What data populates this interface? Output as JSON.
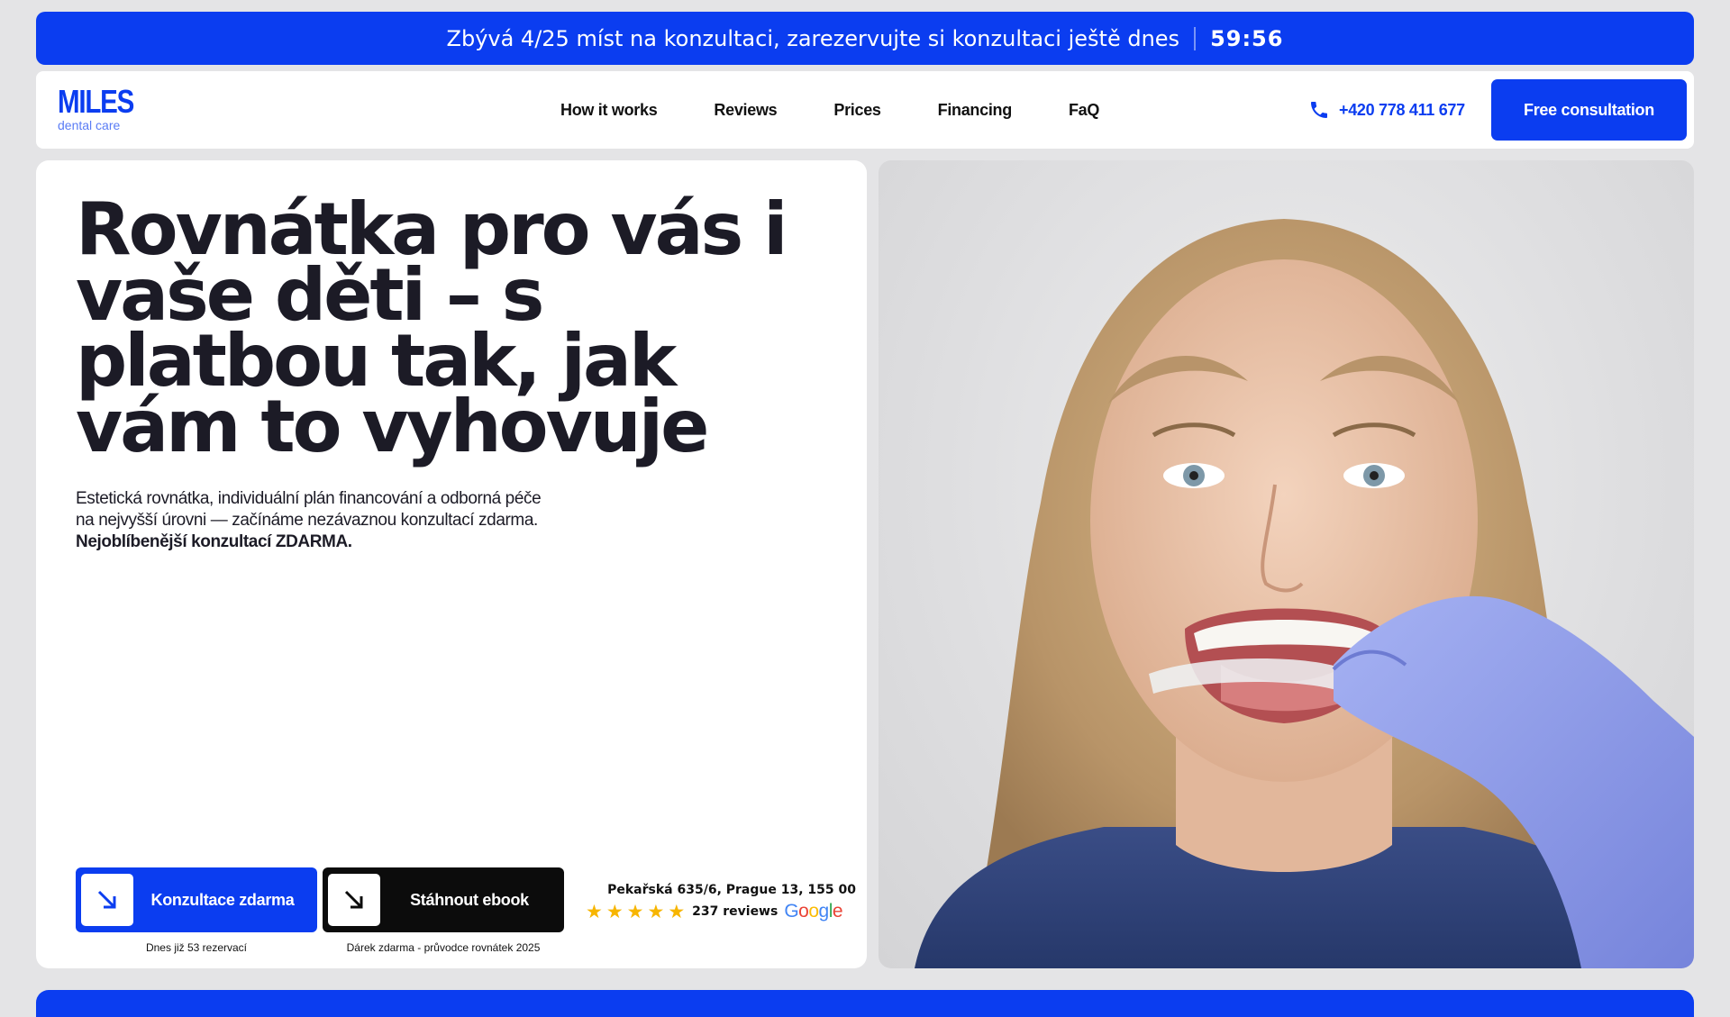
{
  "announcement": {
    "text": "Zbývá 4/25 míst na konzultaci, zarezervujte si konzultaci ještě dnes",
    "timer": "59:56"
  },
  "nav": {
    "logo_main": "MILES",
    "logo_sub": "dental care",
    "items": [
      {
        "label": "How it works"
      },
      {
        "label": "Reviews"
      },
      {
        "label": "Prices"
      },
      {
        "label": "Financing"
      },
      {
        "label": "FaQ"
      }
    ],
    "phone": "+420 778 411 677",
    "cta": "Free consultation"
  },
  "hero": {
    "headline": "Rovnátka pro vás i vaše děti – s platbou tak, jak vám to vyhovuje",
    "subtitle_line1": "Estetická rovnátka, individuální plán financování a odborná péče",
    "subtitle_line2": "na nejvyšší úrovni — začínáme nezávaznou konzultací zdarma.",
    "subtitle_bold": "Nejoblíbenější konzultací ZDARMA.",
    "btn_primary": "Konzultace zdarma",
    "btn_primary_caption": "Dnes již 53 rezervací",
    "btn_secondary": "Stáhnout ebook",
    "btn_secondary_caption": "Dárek zdarma - průvodce rovnátek 2025",
    "address": "Pekařská 635/6, Prague 13, 155 00",
    "rating_stars": 5,
    "reviews_text": "237 reviews",
    "review_source": "Google"
  },
  "colors": {
    "brand_blue": "#0b3df0",
    "background": "#e4e4e6",
    "star": "#f7b500"
  }
}
